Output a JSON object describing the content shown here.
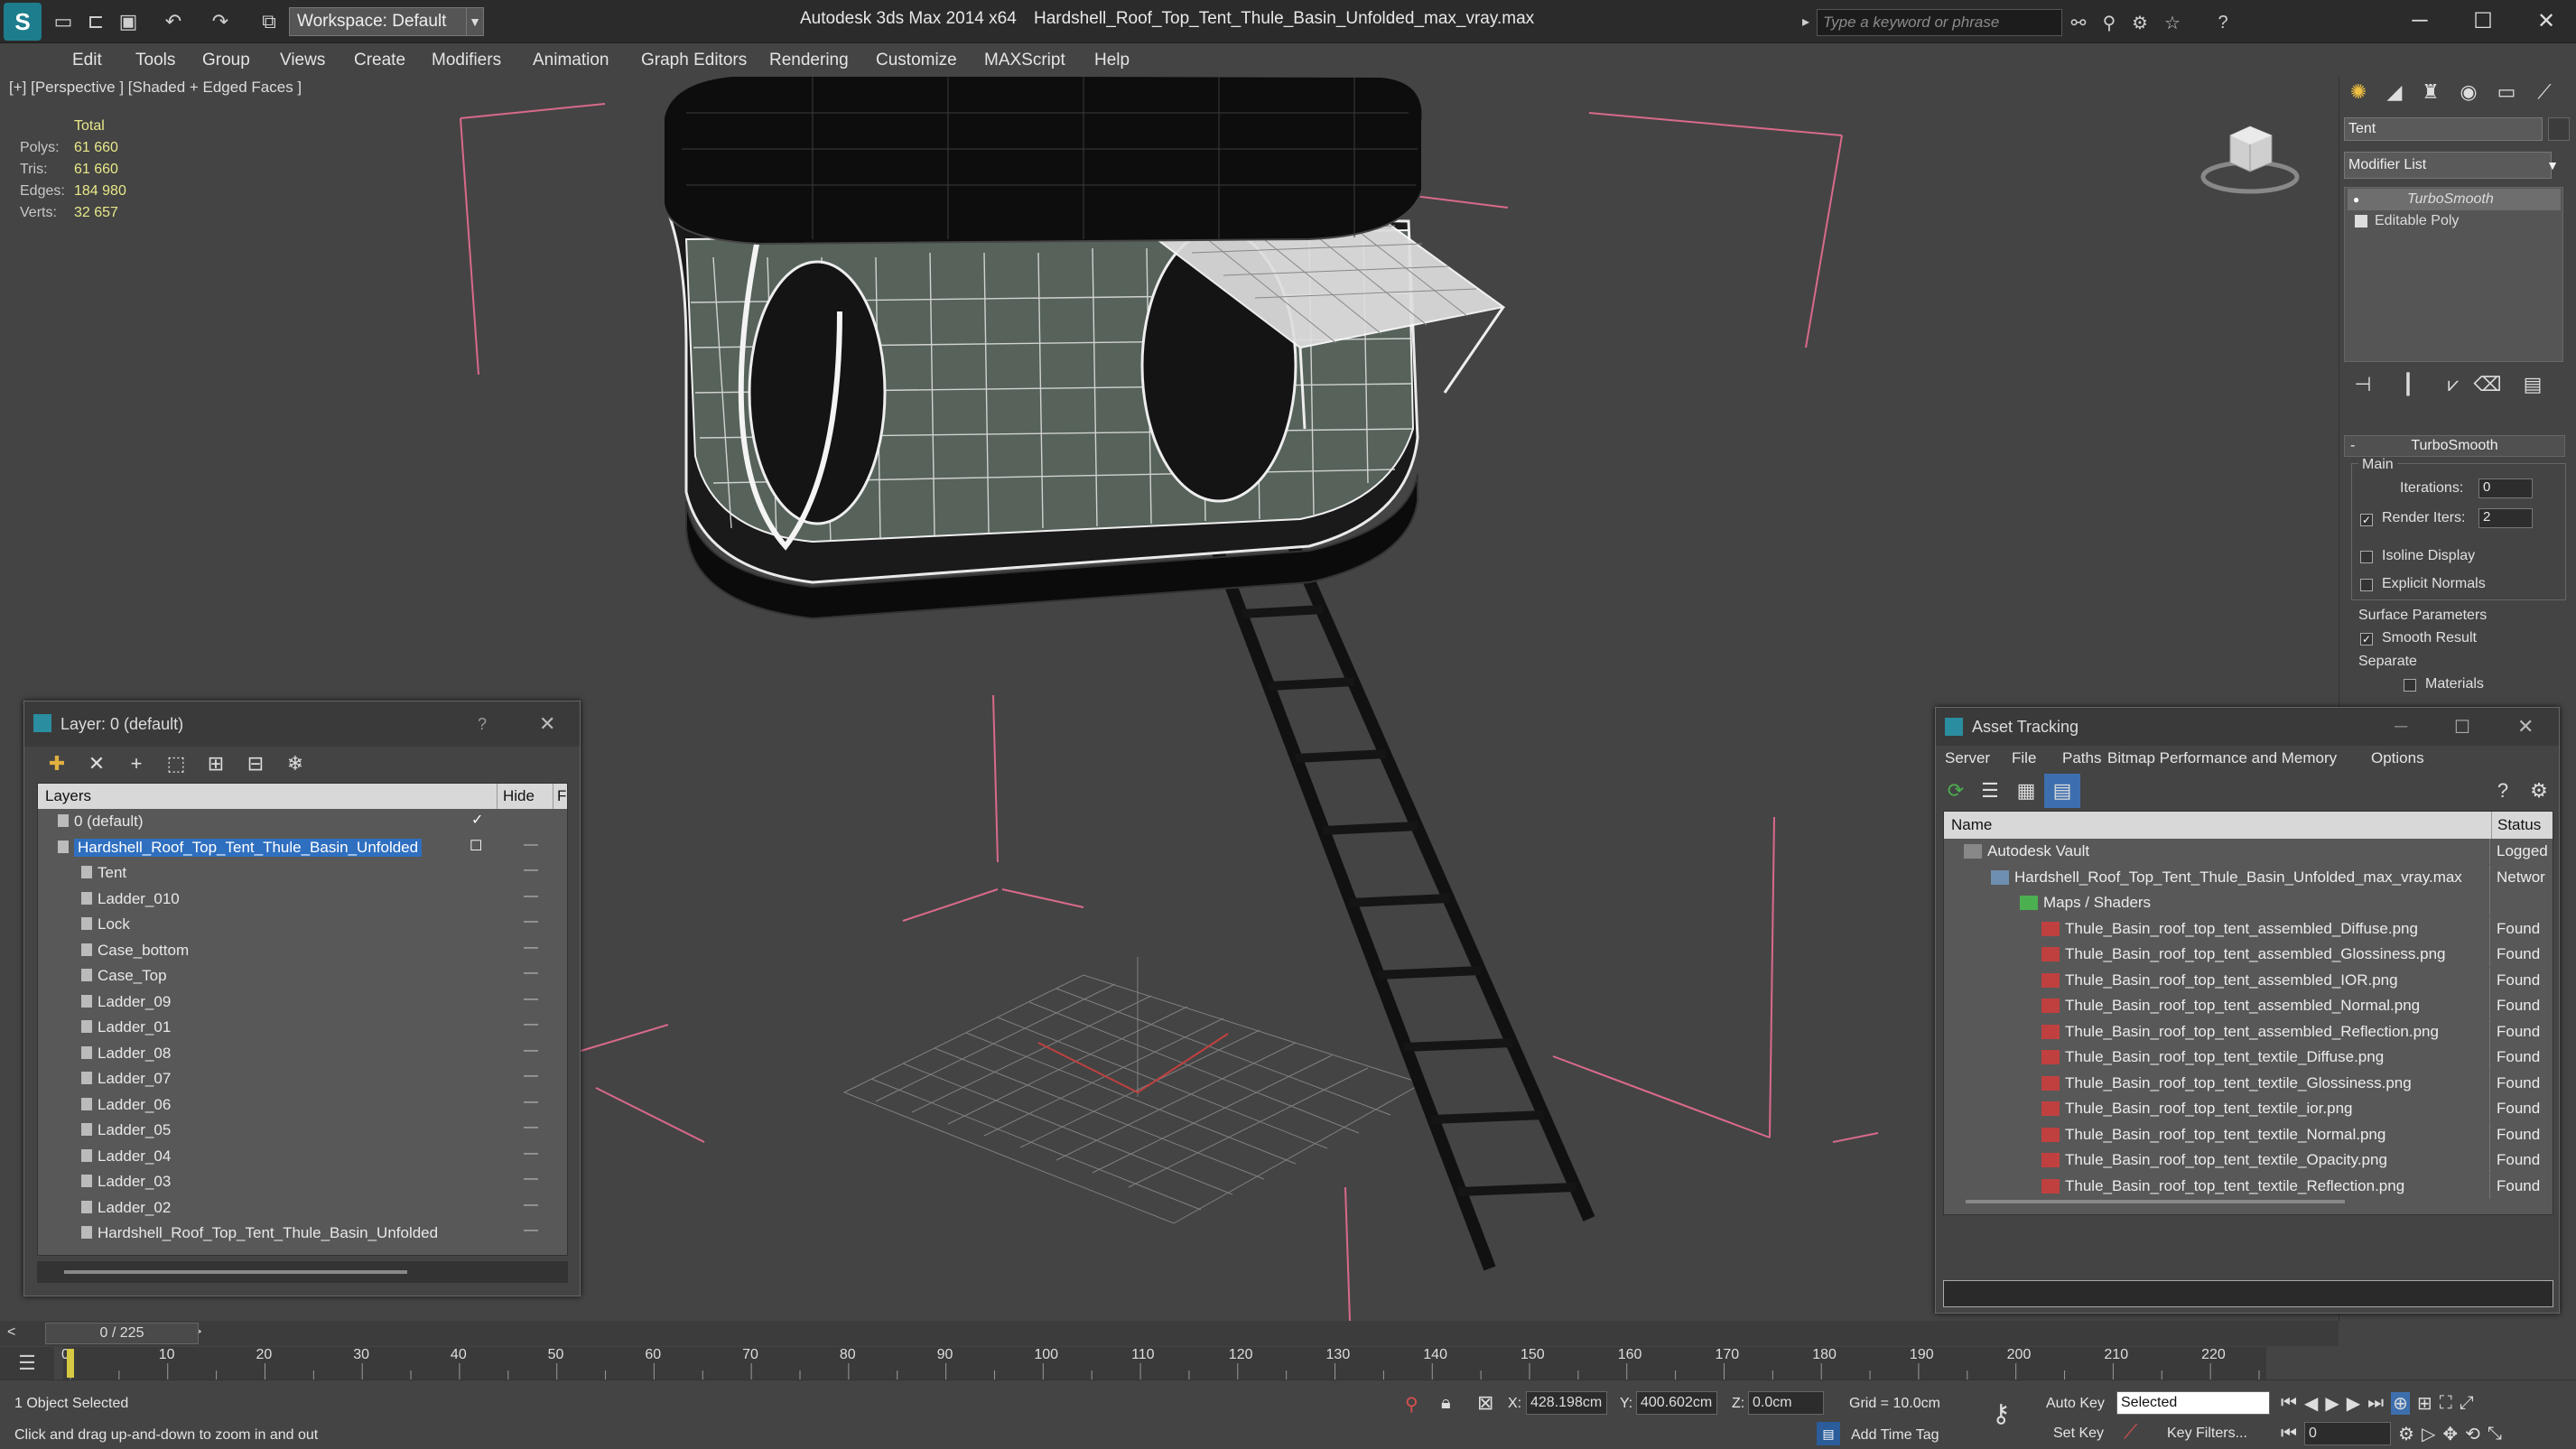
{
  "titlebar": {
    "workspace": "Workspace: Default",
    "app_title": "Autodesk 3ds Max  2014 x64",
    "file_title": "Hardshell_Roof_Top_Tent_Thule_Basin_Unfolded_max_vray.max",
    "search_placeholder": "Type a keyword or phrase"
  },
  "menu": [
    "Edit",
    "Tools",
    "Group",
    "Views",
    "Create",
    "Modifiers",
    "Animation",
    "Graph Editors",
    "Rendering",
    "Customize",
    "MAXScript",
    "Help"
  ],
  "viewport": {
    "label": "[+] [Perspective ] [Shaded + Edged Faces ]",
    "stats_header": "Total",
    "stats": [
      {
        "label": "Polys:",
        "value": "61 660"
      },
      {
        "label": "Tris:",
        "value": "61 660"
      },
      {
        "label": "Edges:",
        "value": "184 980"
      },
      {
        "label": "Verts:",
        "value": "32 657"
      }
    ]
  },
  "command_panel": {
    "object_name": "Tent",
    "modifier_list": "Modifier List",
    "stack": [
      "TurboSmooth",
      "Editable Poly"
    ],
    "rollout_title": "TurboSmooth",
    "main_label": "Main",
    "iterations_label": "Iterations:",
    "iterations_value": "0",
    "render_iters_label": "Render Iters:",
    "render_iters_value": "2",
    "isoline": "Isoline Display",
    "explicit_normals": "Explicit Normals",
    "surface_params": "Surface Parameters",
    "smooth_result": "Smooth Result",
    "separate": "Separate",
    "materials": "Materials"
  },
  "layer_dialog": {
    "title": "Layer: 0 (default)",
    "help": "?",
    "col_layers": "Layers",
    "col_hide": "Hide",
    "col_f": "F",
    "rows": [
      {
        "name": "0 (default)",
        "indent": 1
      },
      {
        "name": "Hardshell_Roof_Top_Tent_Thule_Basin_Unfolded",
        "indent": 1,
        "selected": true
      },
      {
        "name": "Tent",
        "indent": 2
      },
      {
        "name": "Ladder_010",
        "indent": 2
      },
      {
        "name": "Lock",
        "indent": 2
      },
      {
        "name": "Case_bottom",
        "indent": 2
      },
      {
        "name": "Case_Top",
        "indent": 2
      },
      {
        "name": "Ladder_09",
        "indent": 2
      },
      {
        "name": "Ladder_01",
        "indent": 2
      },
      {
        "name": "Ladder_08",
        "indent": 2
      },
      {
        "name": "Ladder_07",
        "indent": 2
      },
      {
        "name": "Ladder_06",
        "indent": 2
      },
      {
        "name": "Ladder_05",
        "indent": 2
      },
      {
        "name": "Ladder_04",
        "indent": 2
      },
      {
        "name": "Ladder_03",
        "indent": 2
      },
      {
        "name": "Ladder_02",
        "indent": 2
      },
      {
        "name": "Hardshell_Roof_Top_Tent_Thule_Basin_Unfolded",
        "indent": 2
      }
    ]
  },
  "asset_dialog": {
    "title": "Asset Tracking",
    "menu": [
      "Server",
      "File",
      "Paths",
      "Bitmap Performance and Memory",
      "Options"
    ],
    "col_name": "Name",
    "col_status": "Status",
    "rows": [
      {
        "name": "Autodesk Vault",
        "status": "Logged",
        "indent": 1,
        "icon": "vault"
      },
      {
        "name": "Hardshell_Roof_Top_Tent_Thule_Basin_Unfolded_max_vray.max",
        "status": "Networ",
        "indent": 2,
        "icon": "max"
      },
      {
        "name": "Maps / Shaders",
        "status": "",
        "indent": 3,
        "icon": "folder"
      },
      {
        "name": "Thule_Basin_roof_top_tent_assembled_Diffuse.png",
        "status": "Found",
        "indent": 4,
        "icon": "png"
      },
      {
        "name": "Thule_Basin_roof_top_tent_assembled_Glossiness.png",
        "status": "Found",
        "indent": 4,
        "icon": "png"
      },
      {
        "name": "Thule_Basin_roof_top_tent_assembled_IOR.png",
        "status": "Found",
        "indent": 4,
        "icon": "png"
      },
      {
        "name": "Thule_Basin_roof_top_tent_assembled_Normal.png",
        "status": "Found",
        "indent": 4,
        "icon": "png"
      },
      {
        "name": "Thule_Basin_roof_top_tent_assembled_Reflection.png",
        "status": "Found",
        "indent": 4,
        "icon": "png"
      },
      {
        "name": "Thule_Basin_roof_top_tent_textile_Diffuse.png",
        "status": "Found",
        "indent": 4,
        "icon": "png"
      },
      {
        "name": "Thule_Basin_roof_top_tent_textile_Glossiness.png",
        "status": "Found",
        "indent": 4,
        "icon": "png"
      },
      {
        "name": "Thule_Basin_roof_top_tent_textile_ior.png",
        "status": "Found",
        "indent": 4,
        "icon": "png"
      },
      {
        "name": "Thule_Basin_roof_top_tent_textile_Normal.png",
        "status": "Found",
        "indent": 4,
        "icon": "png"
      },
      {
        "name": "Thule_Basin_roof_top_tent_textile_Opacity.png",
        "status": "Found",
        "indent": 4,
        "icon": "png"
      },
      {
        "name": "Thule_Basin_roof_top_tent_textile_Reflection.png",
        "status": "Found",
        "indent": 4,
        "icon": "png"
      }
    ]
  },
  "timeline": {
    "frame": "0 / 225",
    "ticks": [
      "0",
      "10",
      "20",
      "30",
      "40",
      "50",
      "60",
      "70",
      "80",
      "90",
      "100",
      "110",
      "120",
      "130",
      "140",
      "150",
      "160",
      "170",
      "180",
      "190",
      "200",
      "210",
      "220"
    ]
  },
  "statusbar": {
    "selected": "1 Object Selected",
    "prompt": "Click and drag up-and-down to zoom in and out",
    "x_label": "X:",
    "x_value": "428.198cm",
    "y_label": "Y:",
    "y_value": "400.602cm",
    "z_label": "Z:",
    "z_value": "0.0cm",
    "grid": "Grid = 10.0cm",
    "auto_key": "Auto Key",
    "set_key": "Set Key",
    "selected_dropdown": "Selected",
    "key_filters": "Key Filters...",
    "add_time_tag": "Add Time Tag",
    "frame_field": "0"
  }
}
